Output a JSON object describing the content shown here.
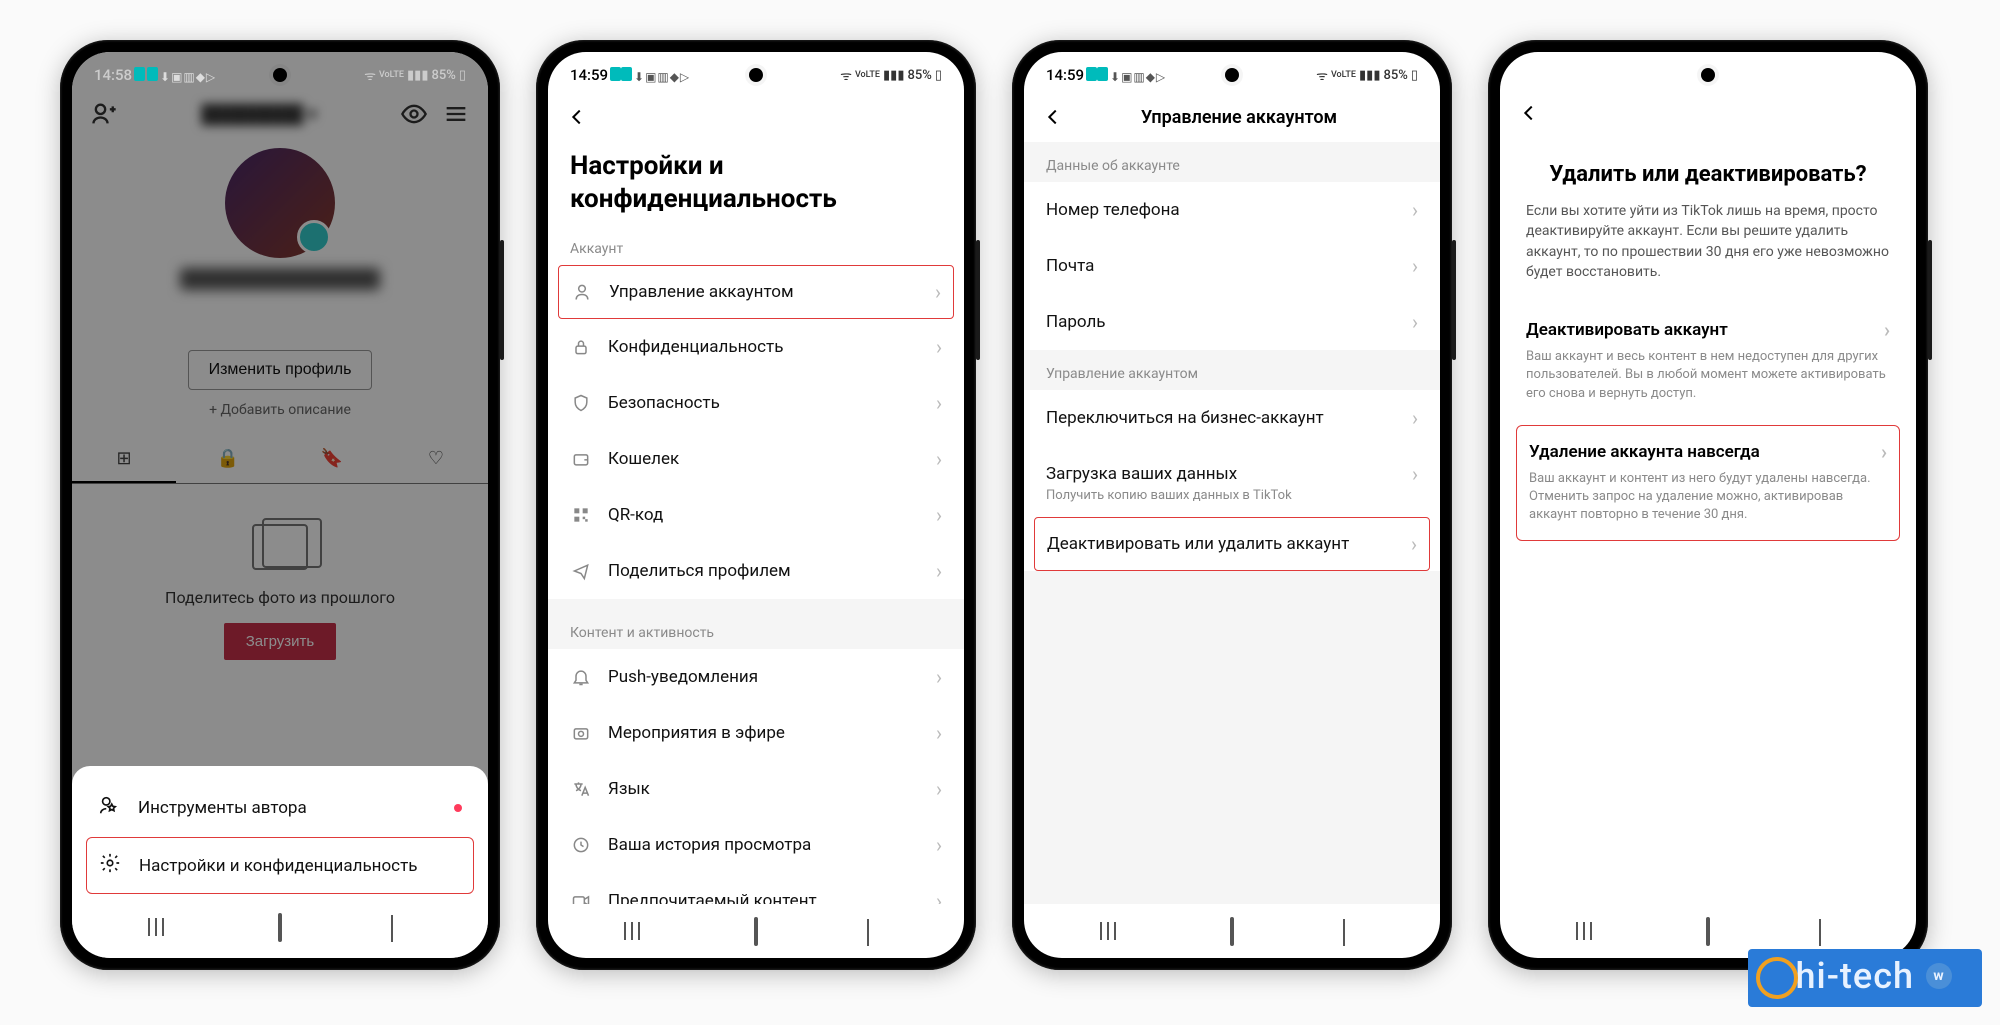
{
  "statusbar": {
    "battery": "85%",
    "signal_label": "VoLTE",
    "time1": "14:58",
    "time2": "14:59",
    "time3": "14:59"
  },
  "s1": {
    "edit_profile": "Изменить профиль",
    "add_description": "+ Добавить описание",
    "empty_caption": "Поделитесь фото из прошлого",
    "upload": "Загрузить",
    "sheet": {
      "creator_tools": "Инструменты автора",
      "settings_privacy": "Настройки и конфиденциальность"
    }
  },
  "s2": {
    "title": "Настройки и конфиденциальность",
    "section_account": "Аккаунт",
    "items_account": [
      "Управление аккаунтом",
      "Конфиденциальность",
      "Безопасность",
      "Кошелек",
      "QR-код",
      "Поделиться профилем"
    ],
    "section_content": "Контент и активность",
    "items_content": [
      "Push-уведомления",
      "Мероприятия в эфире",
      "Язык",
      "Ваша история просмотра",
      "Предпочитаемый контент"
    ]
  },
  "s3": {
    "title": "Управление аккаунтом",
    "section_data": "Данные об аккаунте",
    "items_data": [
      "Номер телефона",
      "Почта",
      "Пароль"
    ],
    "section_manage": "Управление аккаунтом",
    "switch_business": "Переключиться на бизнес-аккаунт",
    "download_data": "Загрузка ваших данных",
    "download_sub": "Получить копию ваших данных в TikTok",
    "deactivate_delete": "Деактивировать или удалить аккаунт"
  },
  "s4": {
    "title": "Удалить или деактивировать?",
    "desc": "Если вы хотите уйти из TikTok лишь на время, просто деактивируйте аккаунт. Если вы решите удалить аккаунт, то по прошествии 30 дня его уже невозможно будет восстановить.",
    "opt1_title": "Деактивировать аккаунт",
    "opt1_desc": "Ваш аккаунт и весь контент в нем недоступен для других пользователей. Вы в любой момент можете активировать его снова и вернуть доступ.",
    "opt2_title": "Удаление аккаунта навсегда",
    "opt2_desc": "Ваш аккаунт и контент из него будут удалены навсегда. Отменить запрос на удаление можно, активировав аккаунт повторно в течение 30 дня."
  },
  "watermark": "hi-tech"
}
